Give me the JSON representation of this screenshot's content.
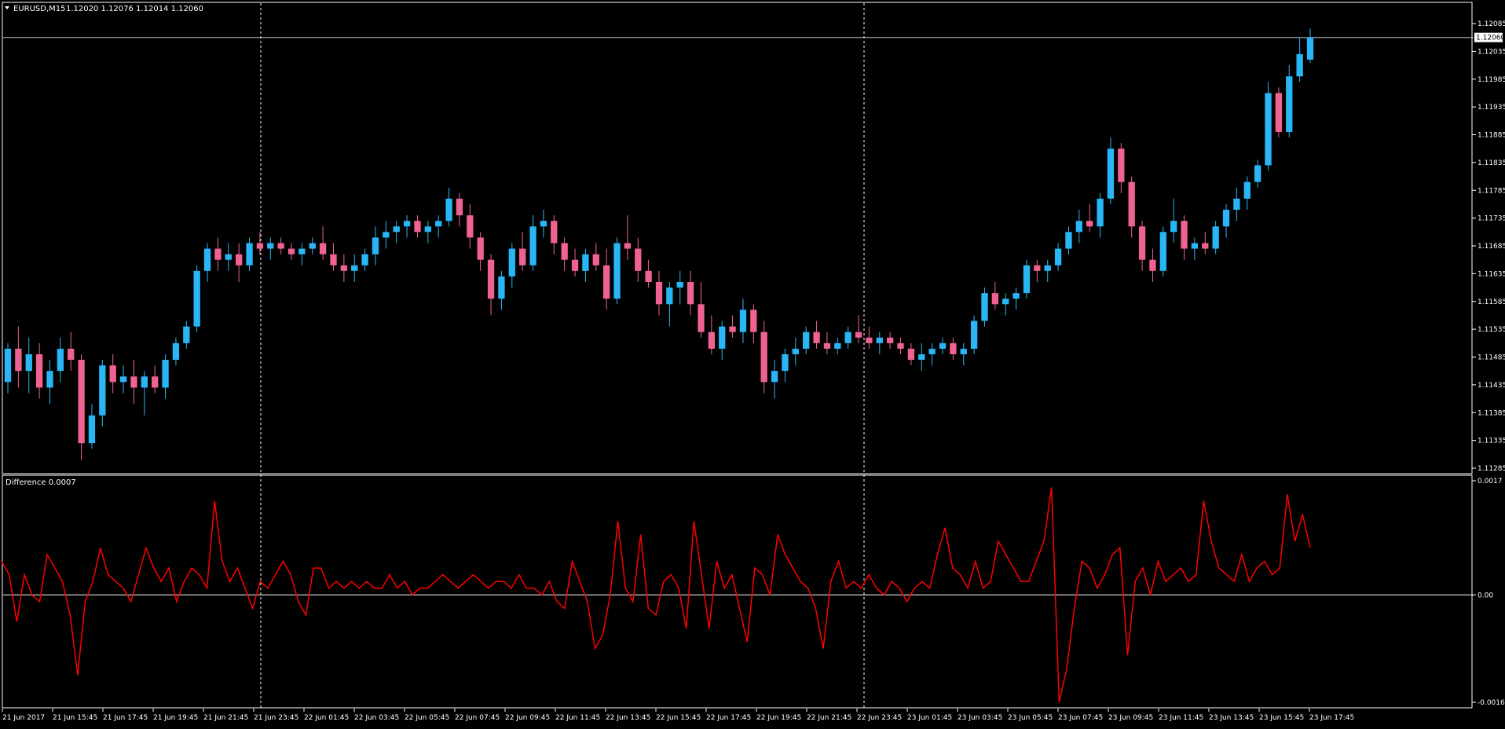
{
  "header": {
    "symbol": "EURUSD,M15",
    "ohlc": "1.12020 1.12076 1.12014 1.12060",
    "triangle_icon": "down-triangle-icon"
  },
  "indicator": {
    "label": "Difference 0.0007",
    "levels": [
      "0.0017",
      "0.00",
      "-0.0016"
    ]
  },
  "colors": {
    "background": "#000000",
    "bull": "#1e90ff",
    "bull_fill": "#29b6f6",
    "bear": "#ff4d6a",
    "bear_fill": "#f06292",
    "line": "#ff0000",
    "axis": "#ffffff",
    "grid_vline": "#ffffff"
  },
  "chart_data": [
    {
      "type": "candlestick",
      "title": "EURUSD,M15",
      "ylim": [
        1.11285,
        1.12085
      ],
      "y_ticks": [
        "1.12085",
        "1.12035",
        "1.11985",
        "1.11935",
        "1.11885",
        "1.11835",
        "1.11785",
        "1.11735",
        "1.11685",
        "1.11635",
        "1.11585",
        "1.11535",
        "1.11485",
        "1.11435",
        "1.11385",
        "1.11335",
        "1.11285"
      ],
      "current_price": "1.12060",
      "x_tick_labels": [
        "21 Jun 2017",
        "21 Jun 15:45",
        "21 Jun 17:45",
        "21 Jun 19:45",
        "21 Jun 21:45",
        "21 Jun 23:45",
        "22 Jun 01:45",
        "22 Jun 03:45",
        "22 Jun 05:45",
        "22 Jun 07:45",
        "22 Jun 09:45",
        "22 Jun 11:45",
        "22 Jun 13:45",
        "22 Jun 15:45",
        "22 Jun 17:45",
        "22 Jun 19:45",
        "22 Jun 21:45",
        "22 Jun 23:45",
        "23 Jun 01:45",
        "23 Jun 03:45",
        "23 Jun 05:45",
        "23 Jun 07:45",
        "23 Jun 09:45",
        "23 Jun 11:45",
        "23 Jun 13:45",
        "23 Jun 15:45",
        "23 Jun 17:45"
      ],
      "candles": [
        [
          1.1144,
          1.1151,
          1.1142,
          1.115
        ],
        [
          1.115,
          1.1154,
          1.1143,
          1.1146
        ],
        [
          1.1146,
          1.1152,
          1.1142,
          1.1149
        ],
        [
          1.1149,
          1.1151,
          1.1141,
          1.1143
        ],
        [
          1.1143,
          1.1148,
          1.114,
          1.1146
        ],
        [
          1.1146,
          1.1152,
          1.1144,
          1.115
        ],
        [
          1.115,
          1.1153,
          1.1146,
          1.1148
        ],
        [
          1.1148,
          1.1149,
          1.113,
          1.1133
        ],
        [
          1.1133,
          1.114,
          1.1132,
          1.1138
        ],
        [
          1.1138,
          1.1148,
          1.1136,
          1.1147
        ],
        [
          1.1147,
          1.1149,
          1.1142,
          1.1144
        ],
        [
          1.1144,
          1.1147,
          1.1142,
          1.1145
        ],
        [
          1.1145,
          1.1148,
          1.114,
          1.1143
        ],
        [
          1.1143,
          1.1146,
          1.1138,
          1.1145
        ],
        [
          1.1145,
          1.1147,
          1.1142,
          1.1143
        ],
        [
          1.1143,
          1.1149,
          1.1141,
          1.1148
        ],
        [
          1.1148,
          1.1152,
          1.1147,
          1.1151
        ],
        [
          1.1151,
          1.1155,
          1.115,
          1.1154
        ],
        [
          1.1154,
          1.1165,
          1.1153,
          1.1164
        ],
        [
          1.1164,
          1.1169,
          1.1162,
          1.1168
        ],
        [
          1.1168,
          1.117,
          1.1164,
          1.1166
        ],
        [
          1.1166,
          1.1169,
          1.1164,
          1.1167
        ],
        [
          1.1167,
          1.1169,
          1.1162,
          1.1165
        ],
        [
          1.1165,
          1.117,
          1.1164,
          1.1169
        ],
        [
          1.1169,
          1.1171,
          1.1167,
          1.1168
        ],
        [
          1.1168,
          1.117,
          1.1166,
          1.1169
        ],
        [
          1.1169,
          1.117,
          1.1167,
          1.1168
        ],
        [
          1.1168,
          1.1169,
          1.1166,
          1.1167
        ],
        [
          1.1167,
          1.1169,
          1.1165,
          1.1168
        ],
        [
          1.1168,
          1.117,
          1.1167,
          1.1169
        ],
        [
          1.1169,
          1.1172,
          1.1166,
          1.1167
        ],
        [
          1.1167,
          1.1169,
          1.1164,
          1.1165
        ],
        [
          1.1165,
          1.1167,
          1.1162,
          1.1164
        ],
        [
          1.1164,
          1.1167,
          1.1162,
          1.1165
        ],
        [
          1.1165,
          1.1168,
          1.1164,
          1.1167
        ],
        [
          1.1167,
          1.1172,
          1.1165,
          1.117
        ],
        [
          1.117,
          1.1173,
          1.1168,
          1.1171
        ],
        [
          1.1171,
          1.1173,
          1.1169,
          1.1172
        ],
        [
          1.1172,
          1.1174,
          1.117,
          1.1173
        ],
        [
          1.1173,
          1.1174,
          1.117,
          1.1171
        ],
        [
          1.1171,
          1.1173,
          1.1169,
          1.1172
        ],
        [
          1.1172,
          1.1174,
          1.117,
          1.1173
        ],
        [
          1.1173,
          1.1179,
          1.1172,
          1.1177
        ],
        [
          1.1177,
          1.1178,
          1.1172,
          1.1174
        ],
        [
          1.1174,
          1.1176,
          1.1168,
          1.117
        ],
        [
          1.117,
          1.1171,
          1.1164,
          1.1166
        ],
        [
          1.1166,
          1.1167,
          1.1156,
          1.1159
        ],
        [
          1.1159,
          1.1164,
          1.1157,
          1.1163
        ],
        [
          1.1163,
          1.1169,
          1.1161,
          1.1168
        ],
        [
          1.1168,
          1.1171,
          1.1164,
          1.1165
        ],
        [
          1.1165,
          1.1174,
          1.1164,
          1.1172
        ],
        [
          1.1172,
          1.1175,
          1.117,
          1.1173
        ],
        [
          1.1173,
          1.1174,
          1.1167,
          1.1169
        ],
        [
          1.1169,
          1.117,
          1.1164,
          1.1166
        ],
        [
          1.1166,
          1.1168,
          1.1163,
          1.1164
        ],
        [
          1.1164,
          1.1168,
          1.1162,
          1.1167
        ],
        [
          1.1167,
          1.1169,
          1.1164,
          1.1165
        ],
        [
          1.1165,
          1.1168,
          1.1157,
          1.1159
        ],
        [
          1.1159,
          1.117,
          1.1158,
          1.1169
        ],
        [
          1.1169,
          1.1174,
          1.1166,
          1.1168
        ],
        [
          1.1168,
          1.117,
          1.1162,
          1.1164
        ],
        [
          1.1164,
          1.1166,
          1.1161,
          1.1162
        ],
        [
          1.1162,
          1.1164,
          1.1156,
          1.1158
        ],
        [
          1.1158,
          1.1162,
          1.1154,
          1.1161
        ],
        [
          1.1161,
          1.1164,
          1.1158,
          1.1162
        ],
        [
          1.1162,
          1.1164,
          1.1156,
          1.1158
        ],
        [
          1.1158,
          1.1162,
          1.1152,
          1.1153
        ],
        [
          1.1153,
          1.1156,
          1.1149,
          1.115
        ],
        [
          1.115,
          1.1155,
          1.1148,
          1.1154
        ],
        [
          1.1154,
          1.1156,
          1.1152,
          1.1153
        ],
        [
          1.1153,
          1.1159,
          1.1151,
          1.1157
        ],
        [
          1.1157,
          1.1158,
          1.1151,
          1.1153
        ],
        [
          1.1153,
          1.1155,
          1.1142,
          1.1144
        ],
        [
          1.1144,
          1.1148,
          1.1141,
          1.1146
        ],
        [
          1.1146,
          1.115,
          1.1144,
          1.1149
        ],
        [
          1.1149,
          1.1152,
          1.1147,
          1.115
        ],
        [
          1.115,
          1.1154,
          1.1149,
          1.1153
        ],
        [
          1.1153,
          1.1155,
          1.115,
          1.1151
        ],
        [
          1.1151,
          1.1153,
          1.1149,
          1.115
        ],
        [
          1.115,
          1.1152,
          1.1149,
          1.1151
        ],
        [
          1.1151,
          1.1154,
          1.115,
          1.1153
        ],
        [
          1.1153,
          1.1156,
          1.1151,
          1.1152
        ],
        [
          1.1152,
          1.1154,
          1.115,
          1.1151
        ],
        [
          1.1151,
          1.1153,
          1.1149,
          1.1152
        ],
        [
          1.1152,
          1.1153,
          1.115,
          1.1151
        ],
        [
          1.1151,
          1.1152,
          1.1149,
          1.115
        ],
        [
          1.115,
          1.1151,
          1.1147,
          1.1148
        ],
        [
          1.1148,
          1.1151,
          1.1146,
          1.1149
        ],
        [
          1.1149,
          1.1151,
          1.1147,
          1.115
        ],
        [
          1.115,
          1.1152,
          1.1149,
          1.1151
        ],
        [
          1.1151,
          1.1152,
          1.1148,
          1.1149
        ],
        [
          1.1149,
          1.1151,
          1.1147,
          1.115
        ],
        [
          1.115,
          1.1156,
          1.1149,
          1.1155
        ],
        [
          1.1155,
          1.1161,
          1.1154,
          1.116
        ],
        [
          1.116,
          1.1162,
          1.1157,
          1.1158
        ],
        [
          1.1158,
          1.116,
          1.1156,
          1.1159
        ],
        [
          1.1159,
          1.1161,
          1.1157,
          1.116
        ],
        [
          1.116,
          1.1166,
          1.1159,
          1.1165
        ],
        [
          1.1165,
          1.1166,
          1.1162,
          1.1164
        ],
        [
          1.1164,
          1.1166,
          1.1162,
          1.1165
        ],
        [
          1.1165,
          1.1169,
          1.1164,
          1.1168
        ],
        [
          1.1168,
          1.1172,
          1.1167,
          1.1171
        ],
        [
          1.1171,
          1.1175,
          1.1169,
          1.1173
        ],
        [
          1.1173,
          1.1176,
          1.1171,
          1.1172
        ],
        [
          1.1172,
          1.1178,
          1.117,
          1.1177
        ],
        [
          1.1177,
          1.1188,
          1.1176,
          1.1186
        ],
        [
          1.1186,
          1.1187,
          1.1178,
          1.118
        ],
        [
          1.118,
          1.1181,
          1.117,
          1.1172
        ],
        [
          1.1172,
          1.1173,
          1.1164,
          1.1166
        ],
        [
          1.1166,
          1.1168,
          1.1162,
          1.1164
        ],
        [
          1.1164,
          1.1172,
          1.1163,
          1.1171
        ],
        [
          1.1171,
          1.1177,
          1.1169,
          1.1173
        ],
        [
          1.1173,
          1.1174,
          1.1166,
          1.1168
        ],
        [
          1.1168,
          1.117,
          1.1166,
          1.1169
        ],
        [
          1.1169,
          1.1171,
          1.1167,
          1.1168
        ],
        [
          1.1168,
          1.1173,
          1.1167,
          1.1172
        ],
        [
          1.1172,
          1.1176,
          1.117,
          1.1175
        ],
        [
          1.1175,
          1.1179,
          1.1173,
          1.1177
        ],
        [
          1.1177,
          1.1181,
          1.1175,
          1.118
        ],
        [
          1.118,
          1.1184,
          1.1179,
          1.1183
        ],
        [
          1.1183,
          1.1198,
          1.1182,
          1.1196
        ],
        [
          1.1196,
          1.1197,
          1.1188,
          1.1189
        ],
        [
          1.1189,
          1.1201,
          1.1188,
          1.1199
        ],
        [
          1.1199,
          1.1206,
          1.1198,
          1.1203
        ],
        [
          1.1202,
          1.12076,
          1.12014,
          1.1206
        ]
      ]
    },
    {
      "type": "line",
      "title": "Difference 0.0007",
      "ylim": [
        -0.0016,
        0.0017
      ],
      "y_ticks": [
        "0.0017",
        "0.00",
        "-0.0016"
      ],
      "series": [
        {
          "values": [
            0.0005,
            0.0003,
            -0.0004,
            0.0003,
            0.0,
            -0.0001,
            0.0006,
            0.0004,
            0.0002,
            -0.0003,
            -0.0012,
            -0.0001,
            0.0002,
            0.0007,
            0.0003,
            0.0002,
            0.0001,
            -0.0001,
            0.0003,
            0.0007,
            0.0004,
            0.0002,
            0.0004,
            -0.0001,
            0.0002,
            0.0004,
            0.0003,
            0.0001,
            0.0014,
            0.0005,
            0.0002,
            0.0004,
            0.0001,
            -0.0002,
            0.0002,
            0.0001,
            0.0003,
            0.0005,
            0.0003,
            -0.0001,
            -0.0003,
            0.0004,
            0.0004,
            0.0001,
            0.0002,
            0.0001,
            0.0002,
            0.0001,
            0.0002,
            0.0001,
            0.0001,
            0.0003,
            0.0001,
            0.0002,
            0.0,
            0.0001,
            0.0001,
            0.0002,
            0.0003,
            0.0002,
            0.0001,
            0.0002,
            0.0003,
            0.0002,
            0.0001,
            0.0002,
            0.0002,
            0.0001,
            0.0003,
            0.0001,
            0.0001,
            0.0,
            0.0002,
            -0.0001,
            -0.0002,
            0.0005,
            0.0002,
            -0.0001,
            -0.0008,
            -0.0006,
            0.0,
            0.0011,
            0.0001,
            -0.0001,
            0.0009,
            -0.0002,
            -0.0003,
            0.0002,
            0.0003,
            0.0001,
            -0.0005,
            0.0011,
            0.0003,
            -0.0005,
            0.0005,
            0.0001,
            0.0003,
            -0.0002,
            -0.0007,
            0.0004,
            0.0003,
            0.0,
            0.0009,
            0.0006,
            0.0004,
            0.0002,
            0.0001,
            -0.0002,
            -0.0008,
            0.0002,
            0.0005,
            0.0001,
            0.0002,
            0.0001,
            0.0003,
            0.0001,
            0.0,
            0.0002,
            0.0001,
            -0.0001,
            0.0001,
            0.0002,
            0.0001,
            0.0006,
            0.001,
            0.0004,
            0.0003,
            0.0001,
            0.0005,
            0.0001,
            0.0002,
            0.0008,
            0.0006,
            0.0004,
            0.0002,
            0.0002,
            0.0005,
            0.0008,
            0.0016,
            -0.0016,
            -0.0011,
            -0.0002,
            0.0005,
            0.0004,
            0.0001,
            0.0003,
            0.0006,
            0.0007,
            -0.0009,
            0.0002,
            0.0004,
            0.0,
            0.0005,
            0.0002,
            0.0003,
            0.0004,
            0.0002,
            0.0003,
            0.0014,
            0.0008,
            0.0004,
            0.0003,
            0.0002,
            0.0006,
            0.0002,
            0.0004,
            0.0005,
            0.0003,
            0.0004,
            0.0015,
            0.0008,
            0.0012,
            0.0007
          ]
        }
      ]
    }
  ]
}
